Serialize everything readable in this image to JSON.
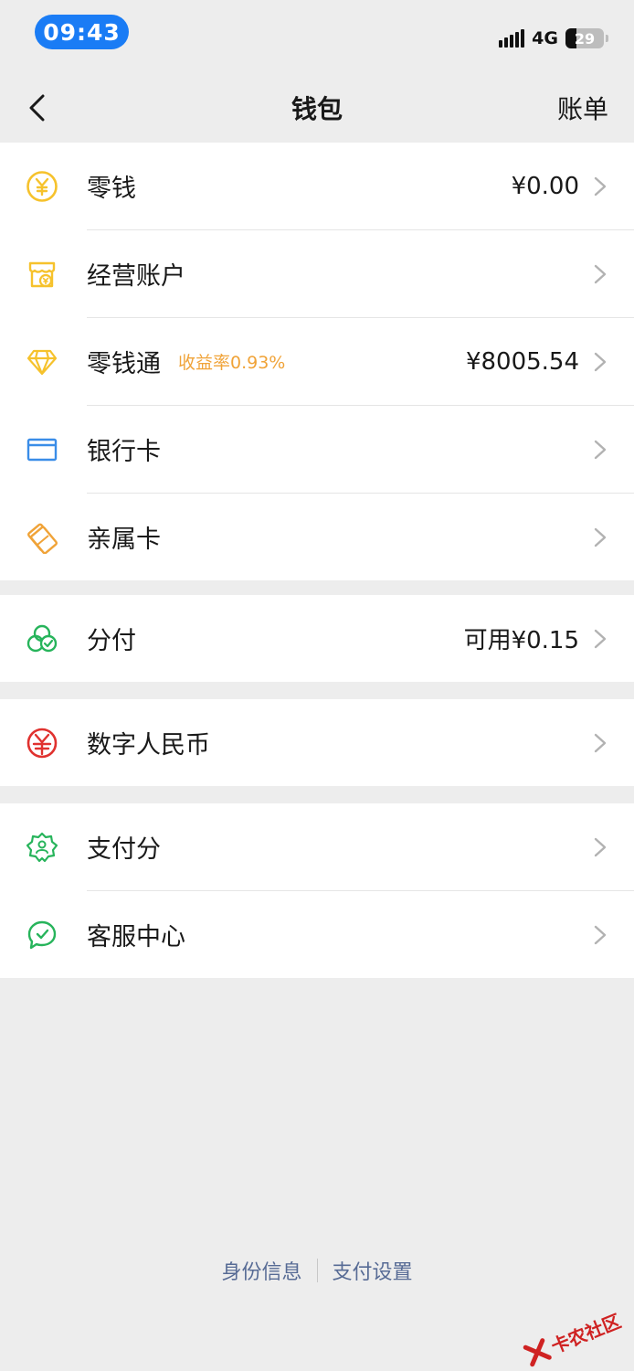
{
  "status_bar": {
    "time": "09:43",
    "network": "4G",
    "battery": "29",
    "battery_level": 0.29
  },
  "nav": {
    "title": "钱包",
    "right_action": "账单"
  },
  "groups": [
    {
      "items": [
        {
          "label": "零钱",
          "value": "¥0.00",
          "icon": "yuan-coin-icon"
        },
        {
          "label": "经营账户",
          "value": "",
          "icon": "shop-account-icon"
        },
        {
          "label": "零钱通",
          "rate": "收益率0.93%",
          "value": "¥8005.54",
          "icon": "diamond-icon"
        },
        {
          "label": "银行卡",
          "value": "",
          "icon": "bank-card-icon"
        },
        {
          "label": "亲属卡",
          "value": "",
          "icon": "family-card-icon"
        }
      ]
    },
    {
      "items": [
        {
          "label": "分付",
          "value": "可用¥0.15",
          "icon": "fenfu-icon"
        }
      ]
    },
    {
      "items": [
        {
          "label": "数字人民币",
          "value": "",
          "icon": "digital-rmb-icon"
        }
      ]
    },
    {
      "items": [
        {
          "label": "支付分",
          "value": "",
          "icon": "pay-score-icon"
        },
        {
          "label": "客服中心",
          "value": "",
          "icon": "customer-service-icon"
        }
      ]
    }
  ],
  "footer": {
    "link_identity": "身份信息",
    "link_settings": "支付设置"
  },
  "watermark": {
    "text": "卡农社区"
  },
  "colors": {
    "background": "#ededed",
    "yellow": "#f6c22c",
    "orange": "#f0a338",
    "blue": "#3a8de8",
    "green": "#27b45b",
    "red": "#e0322f",
    "link": "#576b95"
  }
}
